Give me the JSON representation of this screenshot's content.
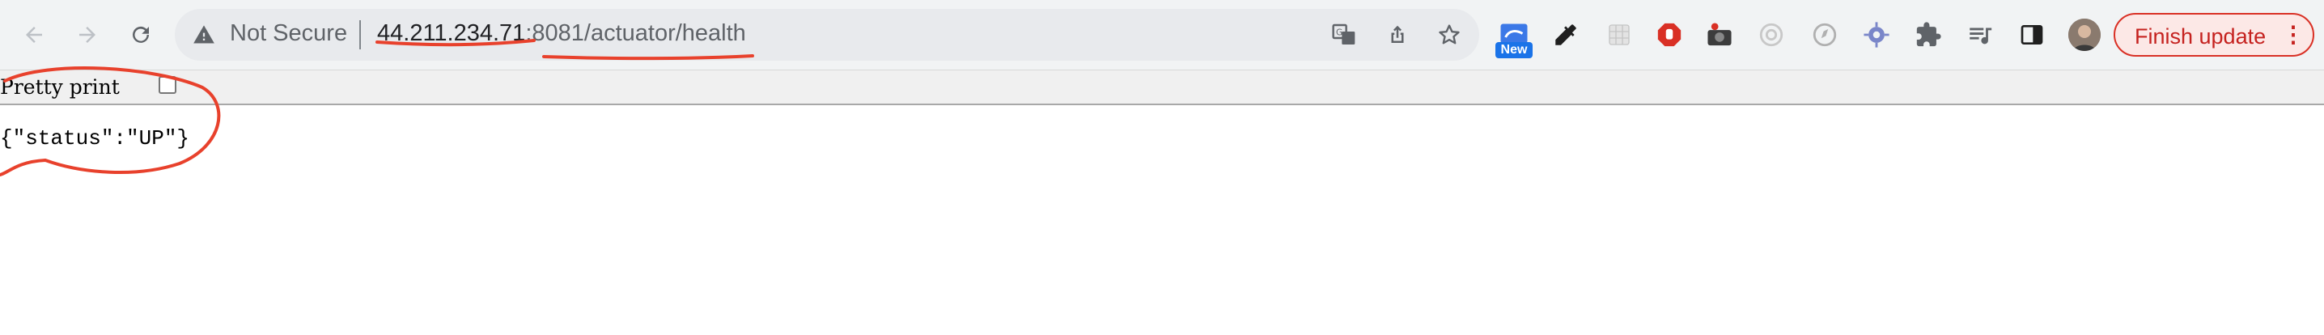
{
  "omnibox": {
    "security_label": "Not Secure",
    "url_host": "44.211.234.71",
    "url_path": ":8081/actuator/health"
  },
  "extensions": {
    "new_badge": "New"
  },
  "update_button": {
    "label": "Finish update"
  },
  "viewer": {
    "pretty_print_label": "Pretty print",
    "pretty_print_checked": false,
    "json_text": "{\"status\":\"UP\"}"
  },
  "colors": {
    "annotation": "#e8412c",
    "update_accent": "#d93025",
    "new_badge": "#1a73e8"
  }
}
